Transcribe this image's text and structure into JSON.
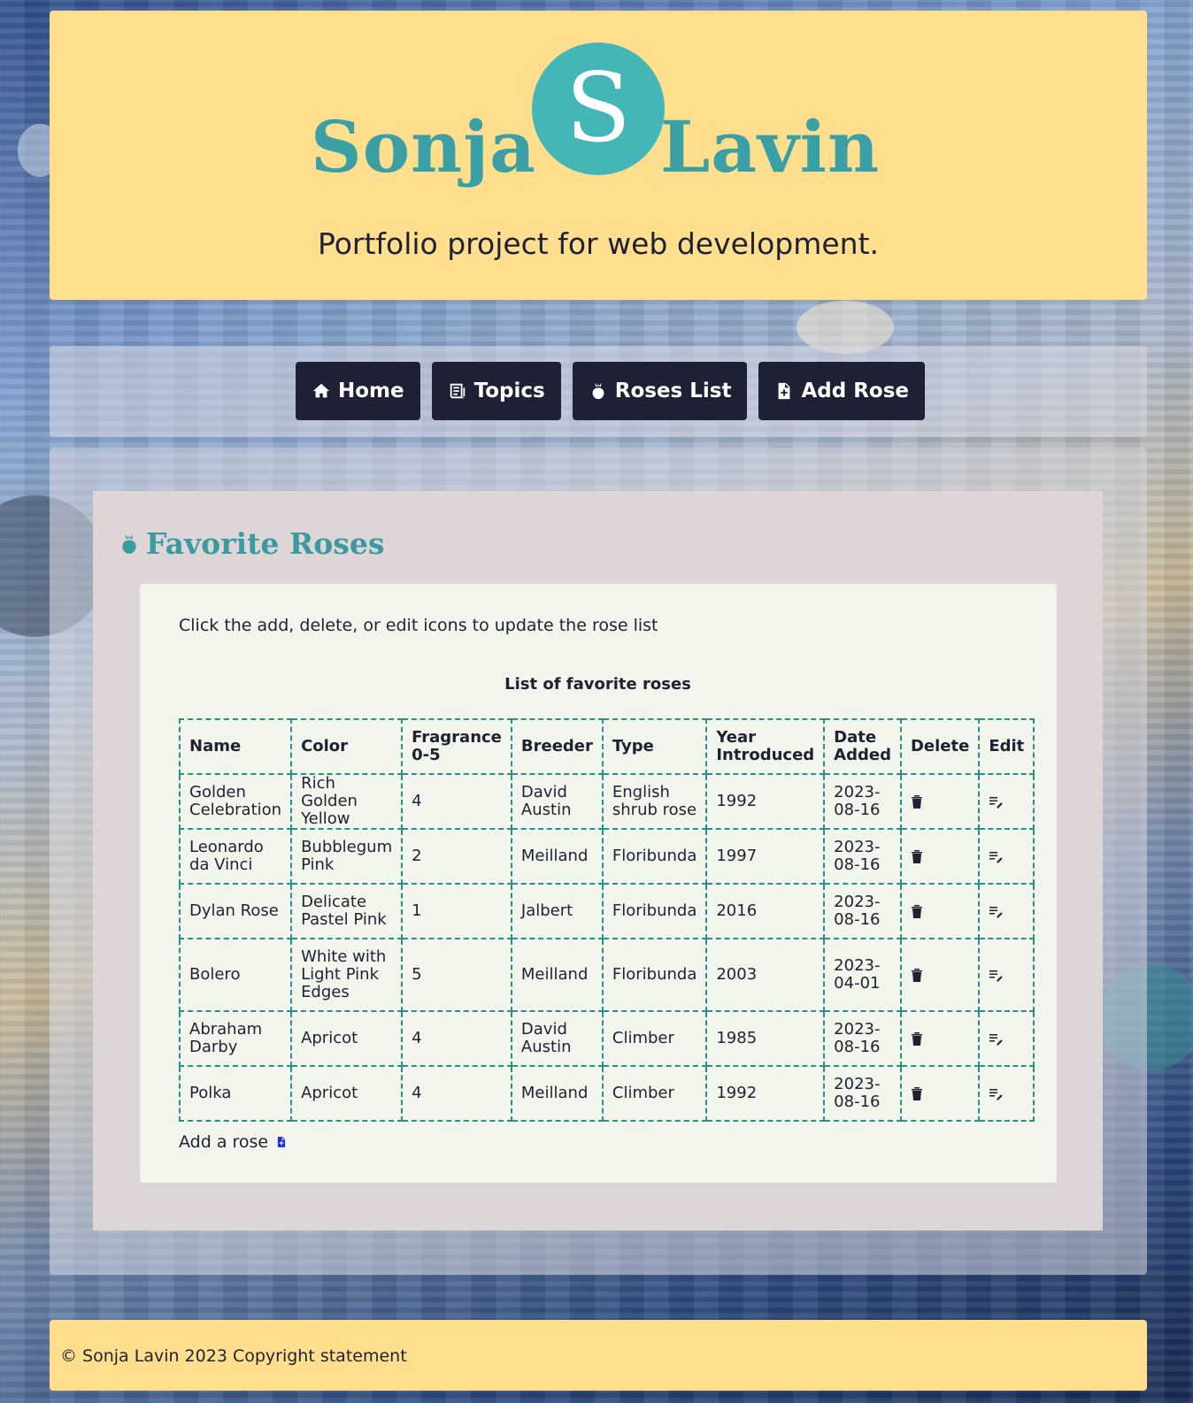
{
  "header": {
    "logo_first": "Sonja",
    "logo_initial": "S",
    "logo_last": "Lavin",
    "tagline": "Portfolio project for web development."
  },
  "nav": {
    "items": [
      {
        "label": "Home",
        "icon": "home-icon"
      },
      {
        "label": "Topics",
        "icon": "newspaper-icon"
      },
      {
        "label": "Roses List",
        "icon": "rose-icon"
      },
      {
        "label": "Add Rose",
        "icon": "file-add-icon"
      }
    ]
  },
  "main": {
    "title": "Favorite Roses",
    "intro": "Click the add, delete, or edit icons to update the rose list",
    "caption": "List of favorite roses",
    "headers": [
      "Name",
      "Color",
      "Fragrance 0-5",
      "Breeder",
      "Type",
      "Year Introduced",
      "Date Added",
      "Delete",
      "Edit"
    ],
    "rows": [
      {
        "name": "Golden Celebration",
        "color": "Rich Golden Yellow",
        "fragrance": "4",
        "breeder": "David Austin",
        "type": "English shrub rose",
        "year": "1992",
        "date": "2023-08-16"
      },
      {
        "name": "Leonardo da Vinci",
        "color": "Bubblegum Pink",
        "fragrance": "2",
        "breeder": "Meilland",
        "type": "Floribunda",
        "year": "1997",
        "date": "2023-08-16"
      },
      {
        "name": "Dylan Rose",
        "color": "Delicate Pastel Pink",
        "fragrance": "1",
        "breeder": "Jalbert",
        "type": "Floribunda",
        "year": "2016",
        "date": "2023-08-16"
      },
      {
        "name": "Bolero",
        "color": "White with Light Pink Edges",
        "fragrance": "5",
        "breeder": "Meilland",
        "type": "Floribunda",
        "year": "2003",
        "date": "2023-04-01"
      },
      {
        "name": "Abraham Darby",
        "color": "Apricot",
        "fragrance": "4",
        "breeder": "David Austin",
        "type": "Climber",
        "year": "1985",
        "date": "2023-08-16"
      },
      {
        "name": "Polka",
        "color": "Apricot",
        "fragrance": "4",
        "breeder": "Meilland",
        "type": "Climber",
        "year": "1992",
        "date": "2023-08-16"
      }
    ],
    "add_label": "Add a rose"
  },
  "footer": {
    "copyright": "© Sonja Lavin 2023 Copyright statement"
  },
  "colors": {
    "header_bg": "#ffdf8d",
    "accent_teal": "#3aa0a5",
    "nav_bg": "#1e2133",
    "card_bg": "#f1f5ec",
    "article_bg": "#ddd5d6",
    "table_border": "#2a8f8a",
    "add_icon": "#1a2ad6"
  }
}
